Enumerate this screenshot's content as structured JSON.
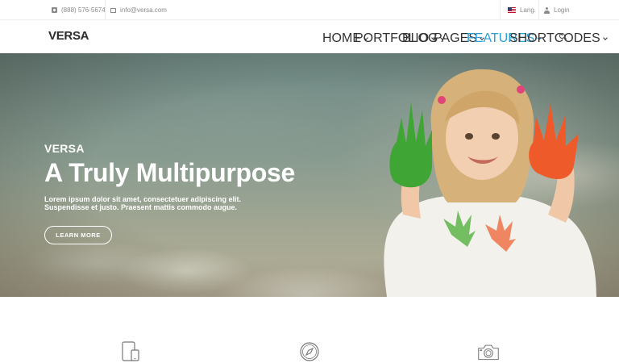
{
  "topbar": {
    "phone": "(888) 576-5674",
    "email": "info@versa.com",
    "lang": "Lang.",
    "login": "Login"
  },
  "header": {
    "logo": "VERSA",
    "nav": [
      {
        "label": "HOME",
        "active": false
      },
      {
        "label": "PORTFOLIO",
        "active": false
      },
      {
        "label": "BLOG",
        "active": false
      },
      {
        "label": "PAGES",
        "active": false
      },
      {
        "label": "FEATURES",
        "active": true
      },
      {
        "label": "SHORTCODES",
        "active": false
      }
    ],
    "accent_color": "#2a9fd6"
  },
  "hero": {
    "kicker": "VERSA",
    "title": "A Truly Multipurpose",
    "description": "Lorem ipsum dolor sit amet, consectetuer adipiscing elit. Suspendisse et justo. Praesent mattis commodo augue.",
    "button": "LEARN MORE"
  },
  "features": {
    "icons": [
      "tablet-phone-icon",
      "compass-icon",
      "camera-icon"
    ]
  }
}
